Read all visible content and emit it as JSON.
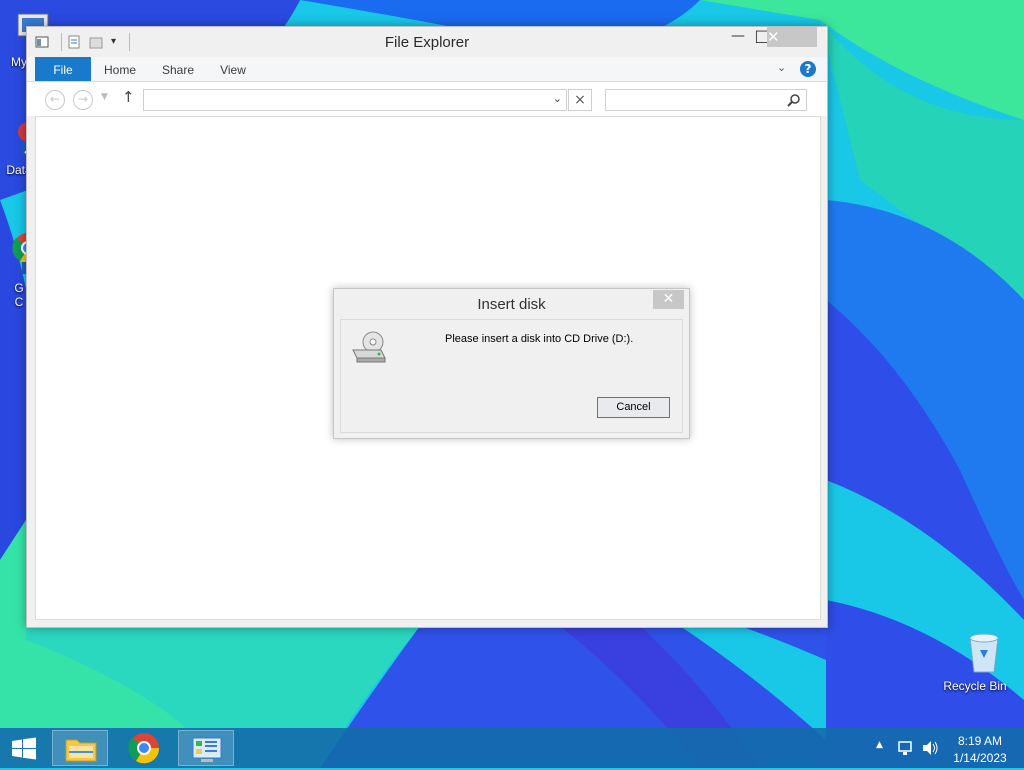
{
  "desktop": {
    "icons": [
      {
        "label": "My C"
      },
      {
        "label": "Data"
      },
      {
        "label": "G\nC"
      },
      {
        "label": "Recycle Bin"
      }
    ]
  },
  "explorer": {
    "title": "File Explorer",
    "tabs": [
      "File",
      "Home",
      "Share",
      "View"
    ],
    "address_value": "",
    "search_placeholder": "",
    "help_glyph": "?",
    "close_glyph": "✕",
    "minimize_glyph": "—",
    "maximize_glyph": "□"
  },
  "dialog": {
    "title": "Insert disk",
    "message": "Please insert a disk into CD Drive (D:).",
    "cancel_label": "Cancel",
    "close_glyph": "✕"
  },
  "taskbar": {
    "items": [
      "start-button",
      "file-explorer",
      "chrome",
      "control-panel"
    ],
    "active_item": "control-panel",
    "clock_time": "8:19 AM",
    "clock_date": "1/14/2023"
  },
  "colors": {
    "accent": "#1979ca",
    "taskbar": "#136cab"
  }
}
